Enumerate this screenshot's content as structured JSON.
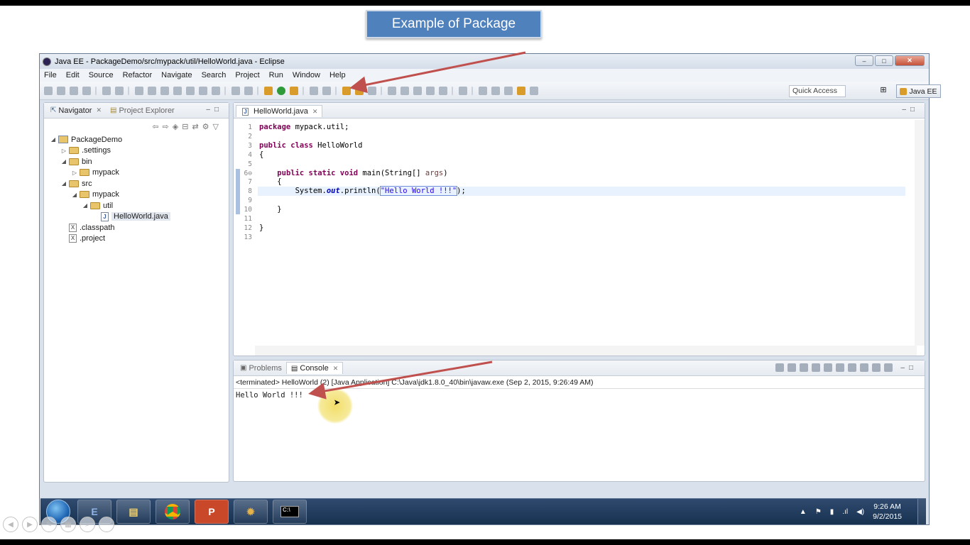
{
  "callout": {
    "text": "Example of Package"
  },
  "window": {
    "title": "Java EE - PackageDemo/src/mypack/util/HelloWorld.java - Eclipse",
    "controls": {
      "minimize": "–",
      "maximize": "□",
      "close": "✕"
    }
  },
  "menu": [
    "File",
    "Edit",
    "Source",
    "Refactor",
    "Navigate",
    "Search",
    "Project",
    "Run",
    "Window",
    "Help"
  ],
  "toolbar": {
    "quick_access": "Quick Access",
    "perspective": "Java EE"
  },
  "navigator": {
    "tabs": [
      "Navigator",
      "Project Explorer"
    ],
    "tree": [
      {
        "label": "PackageDemo",
        "depth": 0,
        "icon": "project-icon",
        "twisty": "◢"
      },
      {
        "label": ".settings",
        "depth": 1,
        "icon": "folder-icon",
        "twisty": "▷"
      },
      {
        "label": "bin",
        "depth": 1,
        "icon": "folder-icon",
        "twisty": "◢"
      },
      {
        "label": "mypack",
        "depth": 2,
        "icon": "folder-icon",
        "twisty": "▷"
      },
      {
        "label": "src",
        "depth": 1,
        "icon": "folder-icon",
        "twisty": "◢"
      },
      {
        "label": "mypack",
        "depth": 2,
        "icon": "folder-icon",
        "twisty": "◢"
      },
      {
        "label": "util",
        "depth": 3,
        "icon": "folder-icon",
        "twisty": "◢"
      },
      {
        "label": "HelloWorld.java",
        "depth": 4,
        "icon": "java-file-icon",
        "twisty": "",
        "selected": true
      },
      {
        "label": ".classpath",
        "depth": 1,
        "icon": "xml-file-icon",
        "twisty": ""
      },
      {
        "label": ".project",
        "depth": 1,
        "icon": "xml-file-icon",
        "twisty": ""
      }
    ]
  },
  "editor": {
    "tab": "HelloWorld.java",
    "lines": [
      {
        "n": "1",
        "segs": [
          {
            "t": "package",
            "c": "kw"
          },
          {
            "t": " mypack.util;"
          }
        ]
      },
      {
        "n": "2",
        "segs": []
      },
      {
        "n": "3",
        "segs": [
          {
            "t": "public class",
            "c": "kw"
          },
          {
            "t": " HelloWorld"
          }
        ]
      },
      {
        "n": "4",
        "segs": [
          {
            "t": "{"
          }
        ]
      },
      {
        "n": "5",
        "segs": []
      },
      {
        "n": "6⊖",
        "segs": [
          {
            "t": "    "
          },
          {
            "t": "public static void",
            "c": "kw"
          },
          {
            "t": " main(String[] "
          },
          {
            "t": "args",
            "c": "kw2"
          },
          {
            "t": ")"
          }
        ]
      },
      {
        "n": "7",
        "segs": [
          {
            "t": "    {"
          }
        ]
      },
      {
        "n": "8",
        "segs": [
          {
            "t": "        System."
          },
          {
            "t": "out",
            "c": "fld"
          },
          {
            "t": ".println("
          },
          {
            "t": "\"Hello World !!!\"",
            "c": "str"
          },
          {
            "t": ");"
          }
        ]
      },
      {
        "n": "9",
        "segs": []
      },
      {
        "n": "10",
        "segs": [
          {
            "t": "    }"
          }
        ]
      },
      {
        "n": "11",
        "segs": []
      },
      {
        "n": "12",
        "segs": [
          {
            "t": "}"
          }
        ]
      },
      {
        "n": "13",
        "segs": []
      }
    ]
  },
  "console": {
    "tabs": [
      "Problems",
      "Console"
    ],
    "status": "<terminated> HelloWorld (2) [Java Application] C:\\Java\\jdk1.8.0_40\\bin\\javaw.exe (Sep 2, 2015, 9:26:49 AM)",
    "output": "Hello World !!!"
  },
  "taskbar": {
    "time": "9:26 AM",
    "date": "9/2/2015",
    "apps": [
      "eclipse-ide-icon",
      "file-explorer-icon",
      "chrome-icon",
      "powerpoint-icon",
      "app-gear-icon",
      "command-prompt-icon"
    ]
  },
  "colors": {
    "arrow": "#c0504d",
    "callout": "#4f81bd",
    "highlight": "#f3de6a"
  }
}
